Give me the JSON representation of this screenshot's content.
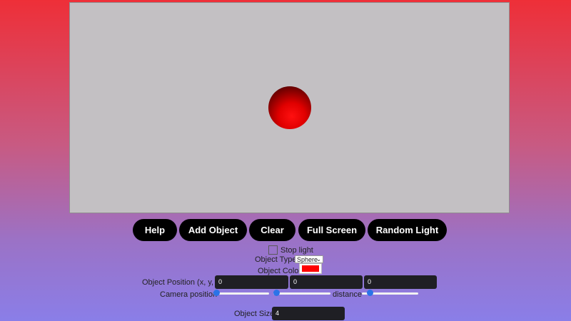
{
  "scene": {
    "object": "sphere",
    "sphere_color": "#ff0000",
    "background_color": "#c3c0c3"
  },
  "toolbar": {
    "help": "Help",
    "add_object": "Add Object",
    "clear": "Clear",
    "full_screen": "Full Screen",
    "random_light": "Random Light"
  },
  "controls": {
    "stop_light_label": "Stop light",
    "stop_light_checked": false,
    "object_type_label": "Object Type:",
    "object_type_value": "Sphere",
    "object_color_label": "Object Color:",
    "object_color_value": "#ff0000",
    "object_position_label": "Object Position (x, y, z):",
    "position_x": "0",
    "position_y": "0",
    "position_z": "0",
    "camera_position_label": "Camera position",
    "distance_label": "distance",
    "camera_slider_1": 0,
    "camera_slider_2": 0,
    "distance_slider": 0.1,
    "object_size_label": "Object Size:",
    "object_size_value": "4"
  },
  "icons": {
    "select_caret": "chevron-down-icon"
  }
}
